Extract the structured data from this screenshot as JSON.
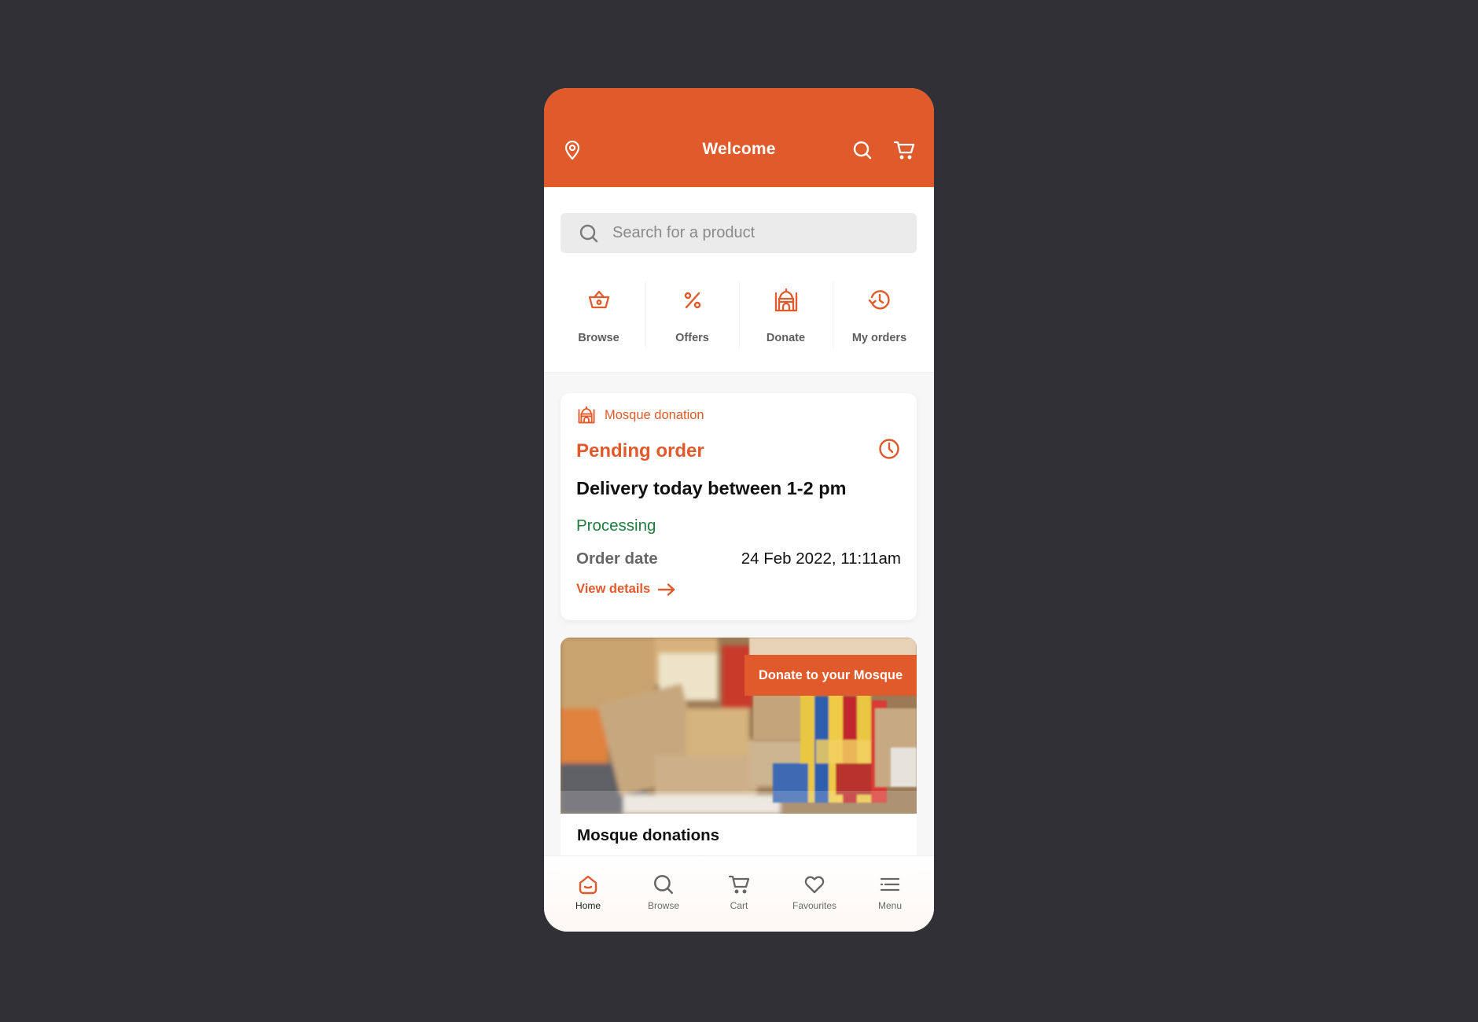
{
  "colors": {
    "accent": "#E05A2B",
    "status_green": "#1E7D3E",
    "backdrop": "#303036",
    "surface": "#F7F7F7"
  },
  "header": {
    "title": "Welcome",
    "left_icon": "location-pin-icon",
    "right_icons": [
      "search-icon",
      "cart-icon"
    ]
  },
  "search": {
    "placeholder": "Search for a product",
    "value": ""
  },
  "quick_actions": [
    {
      "label": "Browse",
      "icon": "basket-icon"
    },
    {
      "label": "Offers",
      "icon": "percent-icon"
    },
    {
      "label": "Donate",
      "icon": "mosque-icon"
    },
    {
      "label": "My orders",
      "icon": "history-icon"
    }
  ],
  "order_card": {
    "category": "Mosque donation",
    "category_icon": "mosque-icon",
    "title": "Pending order",
    "title_icon": "clock-icon",
    "delivery": "Delivery today between 1-2 pm",
    "status": "Processing",
    "date_label": "Order date",
    "date_value": "24 Feb 2022, 11:11am",
    "link_label": "View details",
    "link_icon": "arrow-right-icon"
  },
  "promo_card": {
    "tag": "Donate to your Mosque",
    "title": "Mosque donations",
    "image_description": "Piles of cardboard boxes and grocery packages"
  },
  "tab_bar": {
    "active": "Home",
    "items": [
      {
        "label": "Home",
        "icon": "home-icon"
      },
      {
        "label": "Browse",
        "icon": "search-icon"
      },
      {
        "label": "Cart",
        "icon": "cart-icon"
      },
      {
        "label": "Favourites",
        "icon": "heart-icon"
      },
      {
        "label": "Menu",
        "icon": "menu-icon"
      }
    ]
  }
}
